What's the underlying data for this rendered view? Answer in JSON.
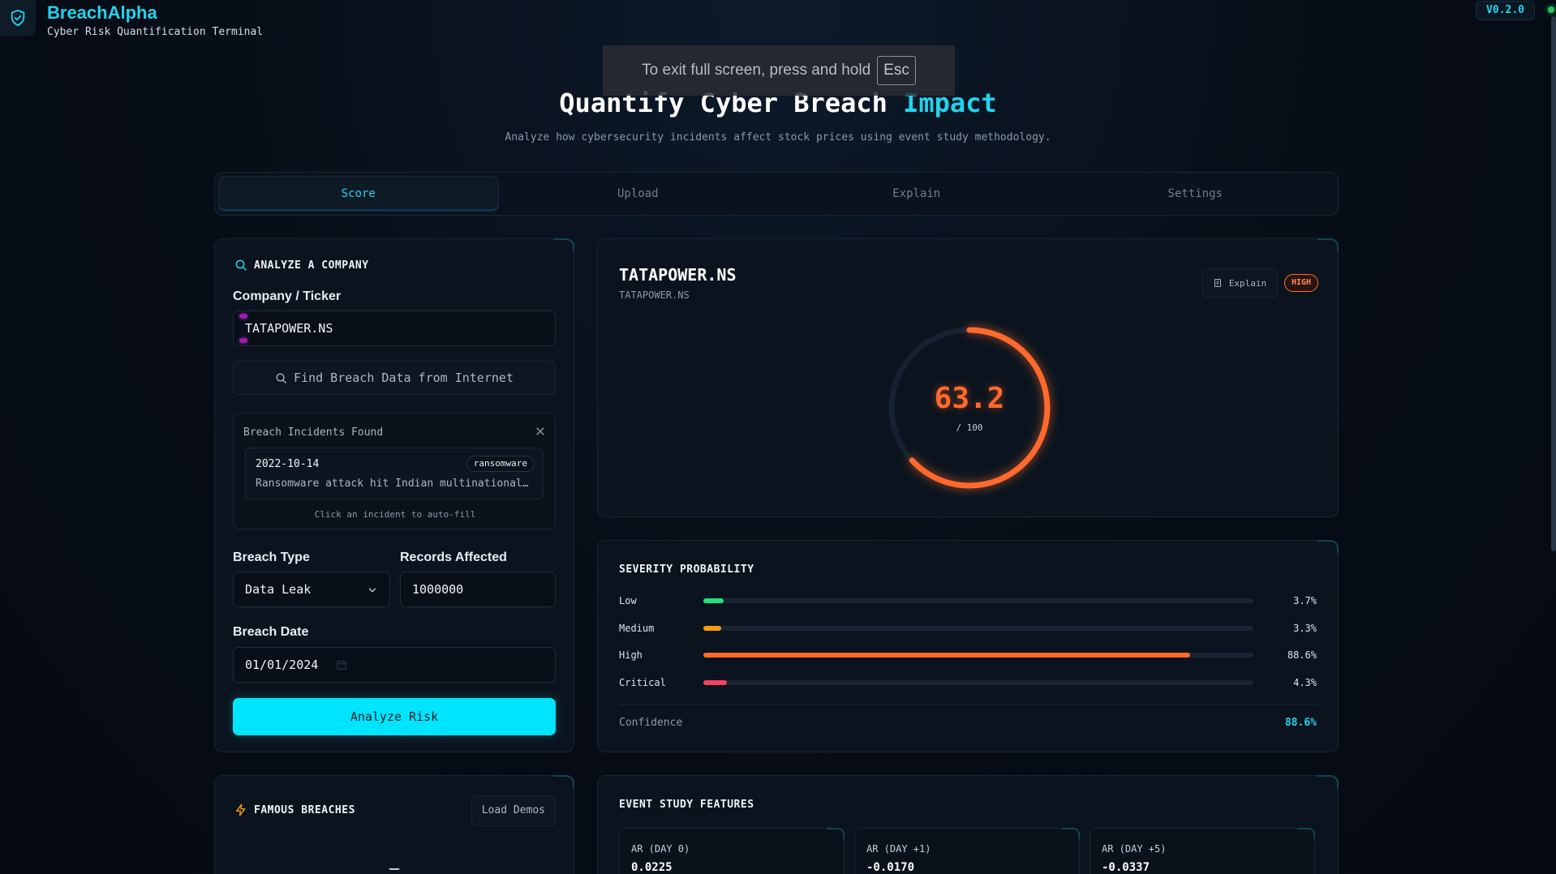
{
  "header": {
    "app_name": "BreachAlpha",
    "subtitle": "Cyber Risk Quantification Terminal",
    "version": "V0.2.0"
  },
  "toast": {
    "message": "To exit full screen, press and hold",
    "key": "Esc"
  },
  "hero": {
    "title_main": "Quantify Cyber Breach ",
    "title_accent": "Impact",
    "subtitle": "Analyze how cybersecurity incidents affect stock prices using event study methodology."
  },
  "tabs": [
    {
      "label": "Score",
      "active": true
    },
    {
      "label": "Upload",
      "active": false
    },
    {
      "label": "Explain",
      "active": false
    },
    {
      "label": "Settings",
      "active": false
    }
  ],
  "analyze": {
    "title": "ANALYZE A COMPANY",
    "company_label": "Company / Ticker",
    "company_value": "TATAPOWER.NS",
    "find_button": "Find Breach Data from Internet",
    "incidents_title": "Breach Incidents Found",
    "incident": {
      "date": "2022-10-14",
      "tag": "ransomware",
      "description": "Ransomware attack hit Indian multinational…"
    },
    "incidents_hint": "Click an incident to auto-fill",
    "breach_type_label": "Breach Type",
    "breach_type_value": "Data Leak",
    "records_label": "Records Affected",
    "records_value": "1000000",
    "date_label": "Breach Date",
    "date_value": "01/01/2024",
    "analyze_button": "Analyze Risk"
  },
  "result": {
    "ticker": "TATAPOWER.NS",
    "ticker_sub": "TATAPOWER.NS",
    "explain_button": "Explain",
    "risk_badge": "HIGH",
    "score": "63.2",
    "score_max": "/ 100",
    "score_fraction": 0.632,
    "colors": {
      "score": "#ff6a2c",
      "track": "#15212e"
    }
  },
  "severity": {
    "title": "SEVERITY PROBABILITY",
    "rows": [
      {
        "label": "Low",
        "value": "3.7%",
        "fraction": 0.037,
        "color": "#22e07a"
      },
      {
        "label": "Medium",
        "value": "3.3%",
        "fraction": 0.033,
        "color": "#f59e0b"
      },
      {
        "label": "High",
        "value": "88.6%",
        "fraction": 0.886,
        "color": "#ff6a2c"
      },
      {
        "label": "Critical",
        "value": "4.3%",
        "fraction": 0.043,
        "color": "#f43f5e"
      }
    ],
    "confidence_label": "Confidence",
    "confidence_value": "88.6%"
  },
  "famous": {
    "title": "FAMOUS BREACHES",
    "load_button": "Load Demos"
  },
  "features": {
    "title": "EVENT STUDY FEATURES",
    "items": [
      {
        "label": "AR (DAY 0)",
        "value": "0.0225"
      },
      {
        "label": "AR (DAY +1)",
        "value": "-0.0170"
      },
      {
        "label": "AR (DAY +5)",
        "value": "-0.0337"
      }
    ]
  }
}
